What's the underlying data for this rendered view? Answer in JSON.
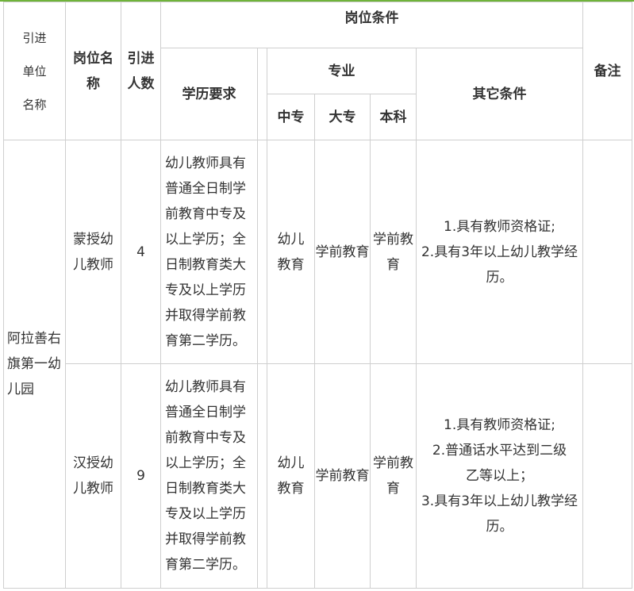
{
  "header": {
    "unit": "引进单位名称",
    "position": "岗位名称",
    "count": "引进人数",
    "conditions": "岗位条件",
    "education": "学历要求",
    "major": "专业",
    "zhongzhuan": "中专",
    "dazhuan": "大专",
    "benke": "本科",
    "other": "其它条件",
    "remarks": "备注"
  },
  "unit_name": "阿拉善右旗第一幼儿园",
  "rows": [
    {
      "position": "蒙授幼儿教师",
      "count": "4",
      "education": "幼儿教师具有普通全日制学前教育中专及以上学历；全日制教育类大专及以上学历并取得学前教育第二学历。",
      "zhongzhuan": "幼儿教育",
      "dazhuan": "学前教育",
      "benke": "学前教育",
      "other": [
        "1.具有教师资格证;",
        "2.具有3年以上幼儿教学经历。"
      ],
      "remarks": ""
    },
    {
      "position": "汉授幼儿教师",
      "count": "9",
      "education": "幼儿教师具有普通全日制学前教育中专及以上学历；全日制教育类大专及以上学历并取得学前教育第二学历。",
      "zhongzhuan": "幼儿教育",
      "dazhuan": "学前教育",
      "benke": "学前教育",
      "other": [
        "1.具有教师资格证;",
        "2.普通话水平达到二级乙等以上；",
        "3.具有3年以上幼儿教学经历。"
      ],
      "remarks": ""
    }
  ]
}
